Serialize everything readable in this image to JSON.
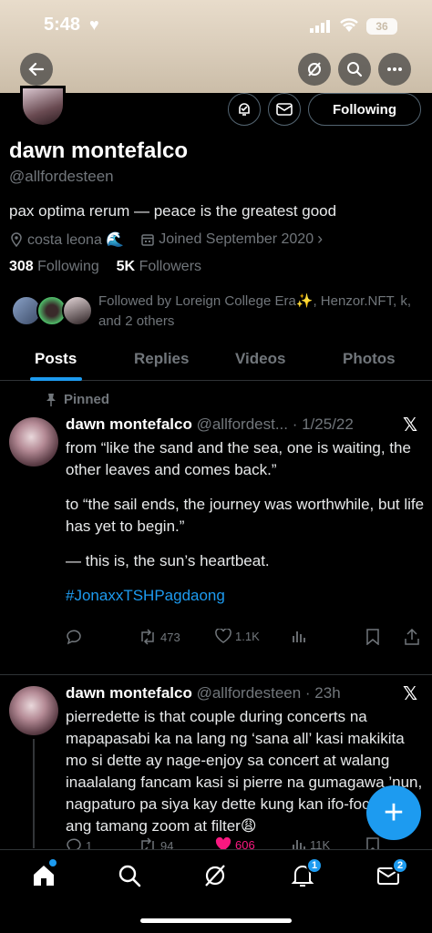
{
  "status_bar": {
    "time": "5:48",
    "battery": "36"
  },
  "profile": {
    "name": "dawn montefalco",
    "handle": "@allfordesteen",
    "bio": "pax optima rerum — peace is the greatest good",
    "location": "costa leona 🌊",
    "joined": "Joined September 2020",
    "following_count": "308",
    "following_label": "Following",
    "followers_count": "5K",
    "followers_label": "Followers",
    "followed_by": "Followed by Loreign College Era✨, Henzor.NFT, k, and 2 others",
    "follow_button": "Following"
  },
  "tabs": [
    "Posts",
    "Replies",
    "Videos",
    "Photos"
  ],
  "posts": [
    {
      "pinned_label": "Pinned",
      "name": "dawn montefalco",
      "handle_date": "@allfordest... · 1/25/22",
      "para1": "from “like the sand and the sea, one is waiting, the other leaves and comes back.”",
      "para2": "to “the sail ends, the journey was worthwhile, but life has yet to begin.”",
      "para3": "— this is, the sun’s heartbeat.",
      "hashtag": "#JonaxxTSHPagdaong",
      "replies": "",
      "reposts": "473",
      "likes": "1.1K",
      "views": ""
    },
    {
      "name": "dawn montefalco",
      "handle_date": "@allfordesteen · 23h",
      "text": "pierredette is that couple during concerts na mapapasabi ka na lang ng ‘sana all’ kasi makikita mo si dette ay nage-enjoy sa concert at walang inaalalang fancam kasi si pierre na gumagawa ’nun, nagpaturo pa siya kay dette kung kan ifo-focus at ang tamang zoom at filter😩",
      "replies": "1",
      "reposts": "94",
      "likes": "606",
      "views": "11K"
    }
  ],
  "nav_badges": {
    "notifications": "1",
    "messages": "2"
  },
  "colors": {
    "accent": "#1d9bf0",
    "like_active": "#f91880",
    "bg": "#000000"
  }
}
